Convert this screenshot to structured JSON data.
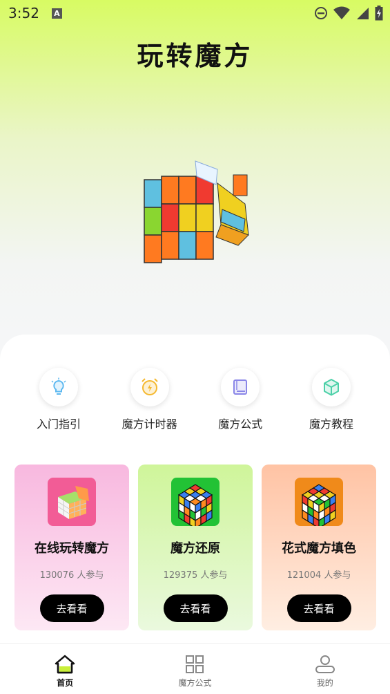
{
  "status_bar": {
    "time": "3:52",
    "notification_icon": "a-icon"
  },
  "header": {
    "title": "玩转魔方"
  },
  "features": [
    {
      "label": "入门指引",
      "icon": "lightbulb-icon",
      "color": "#5cb8f0"
    },
    {
      "label": "魔方计时器",
      "icon": "alarm-clock-icon",
      "color": "#f5b82e"
    },
    {
      "label": "魔方公式",
      "icon": "book-icon",
      "color": "#8a86e8"
    },
    {
      "label": "魔方教程",
      "icon": "cube-icon",
      "color": "#4cd0a8"
    }
  ],
  "cards": [
    {
      "title": "在线玩转魔方",
      "count": "130076 人参与",
      "button": "去看看"
    },
    {
      "title": "魔方还原",
      "count": "129375 人参与",
      "button": "去看看"
    },
    {
      "title": "花式魔方填色",
      "count": "121004 人参与",
      "button": "去看看"
    }
  ],
  "tabbar": [
    {
      "label": "首页",
      "icon": "home-icon",
      "active": true
    },
    {
      "label": "魔方公式",
      "icon": "grid-icon",
      "active": false
    },
    {
      "label": "我的",
      "icon": "user-icon",
      "active": false
    }
  ],
  "colors": {
    "accent": "#d8fb63",
    "button": "#000000"
  }
}
